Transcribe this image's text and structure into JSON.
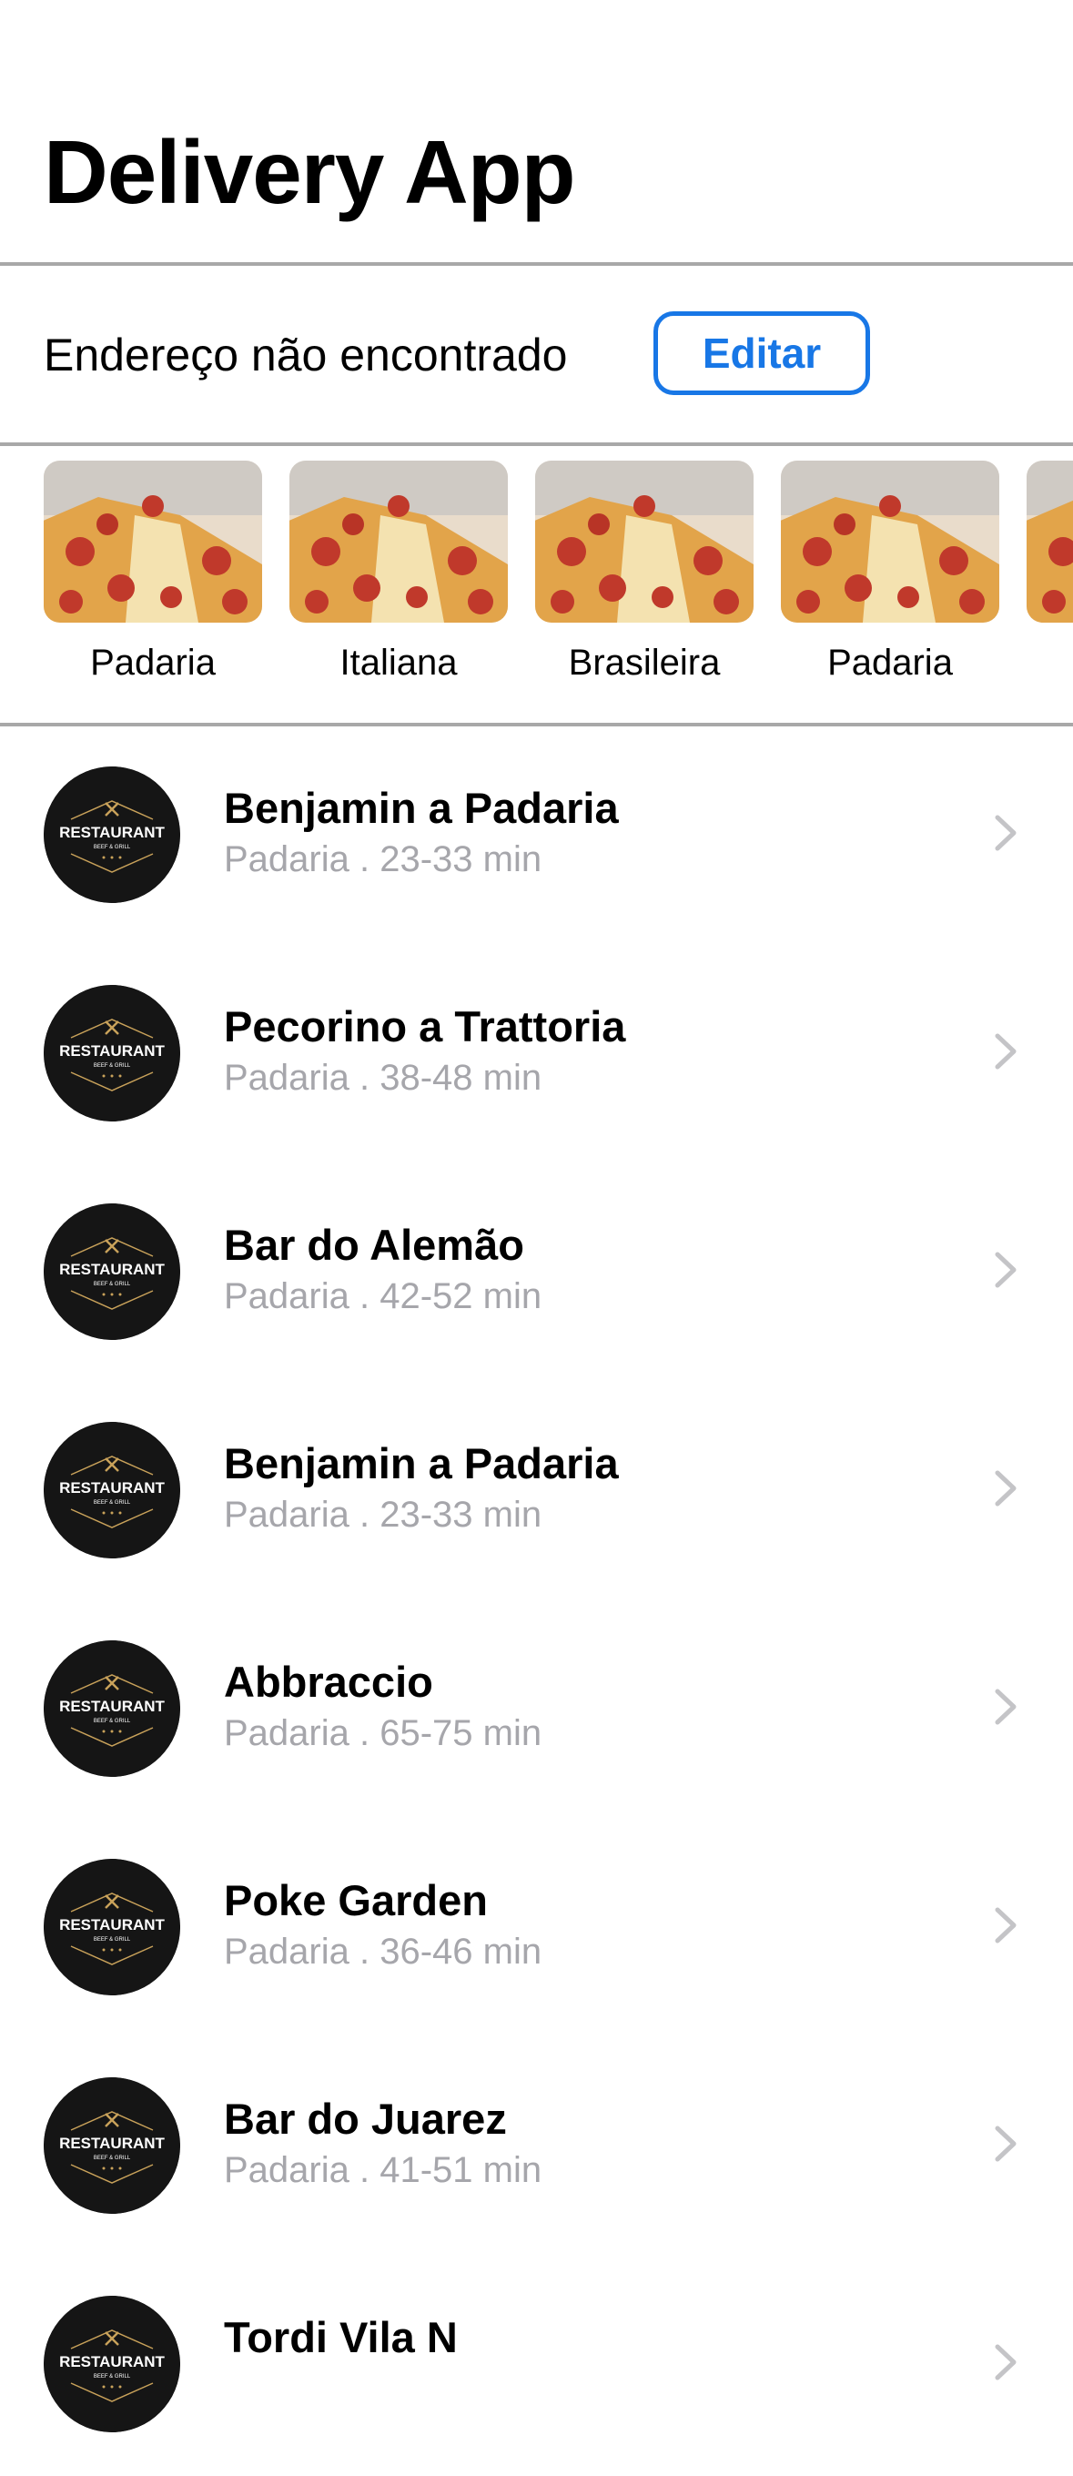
{
  "header": {
    "title": "Delivery App"
  },
  "address": {
    "text": "Endereço não encontrado",
    "edit_label": "Editar"
  },
  "categories": [
    {
      "label": "Padaria",
      "icon": "pizza-image"
    },
    {
      "label": "Italiana",
      "icon": "pizza-image"
    },
    {
      "label": "Brasileira",
      "icon": "pizza-image"
    },
    {
      "label": "Padaria",
      "icon": "pizza-image"
    }
  ],
  "restaurants": [
    {
      "name": "Benjamin a Padaria",
      "meta": "Padaria . 23-33 min"
    },
    {
      "name": "Pecorino a Trattoria",
      "meta": "Padaria . 38-48 min"
    },
    {
      "name": "Bar do Alemão",
      "meta": "Padaria . 42-52 min"
    },
    {
      "name": "Benjamin a Padaria",
      "meta": "Padaria . 23-33 min"
    },
    {
      "name": "Abbraccio",
      "meta": "Padaria . 65-75 min"
    },
    {
      "name": "Poke Garden",
      "meta": "Padaria . 36-46 min"
    },
    {
      "name": "Bar do Juarez",
      "meta": "Padaria . 41-51 min"
    },
    {
      "name": "Tordi Vila N",
      "meta": ""
    }
  ],
  "logo_text": {
    "main": "RESTAURANT",
    "sub": "BEEF & GRILL"
  },
  "colors": {
    "accent": "#1877e6",
    "secondary_text": "#a6a6ab",
    "divider": "#a8a8a8",
    "logo_bg": "#151515",
    "logo_gold": "#c9a25a"
  }
}
